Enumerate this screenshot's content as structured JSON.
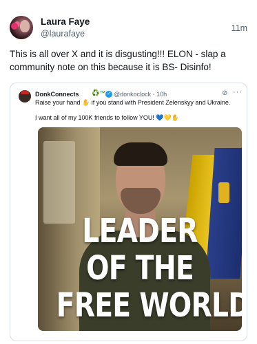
{
  "post": {
    "author_name": "Laura Faye",
    "author_handle": "@laurafaye",
    "time": "11m",
    "text": "This is all over X and it is disgusting!!! ELON - slap a community note on this because it is BS- Disinfo!"
  },
  "quoted_post": {
    "author_name": "DonkConnects",
    "badges": "♻️™",
    "handle_time": "@donkoclock · 10h",
    "line1": "Raise your hand ✋ if you stand with President Zelenskyy and Ukraine.",
    "line2": "I want all of my 100K friends to follow YOU! 💙💛✋",
    "image_headline": [
      "LEADER",
      "OF THE",
      "FREE WORLD"
    ],
    "icons": [
      "grok-icon",
      "more-icon",
      "verified-icon"
    ]
  }
}
